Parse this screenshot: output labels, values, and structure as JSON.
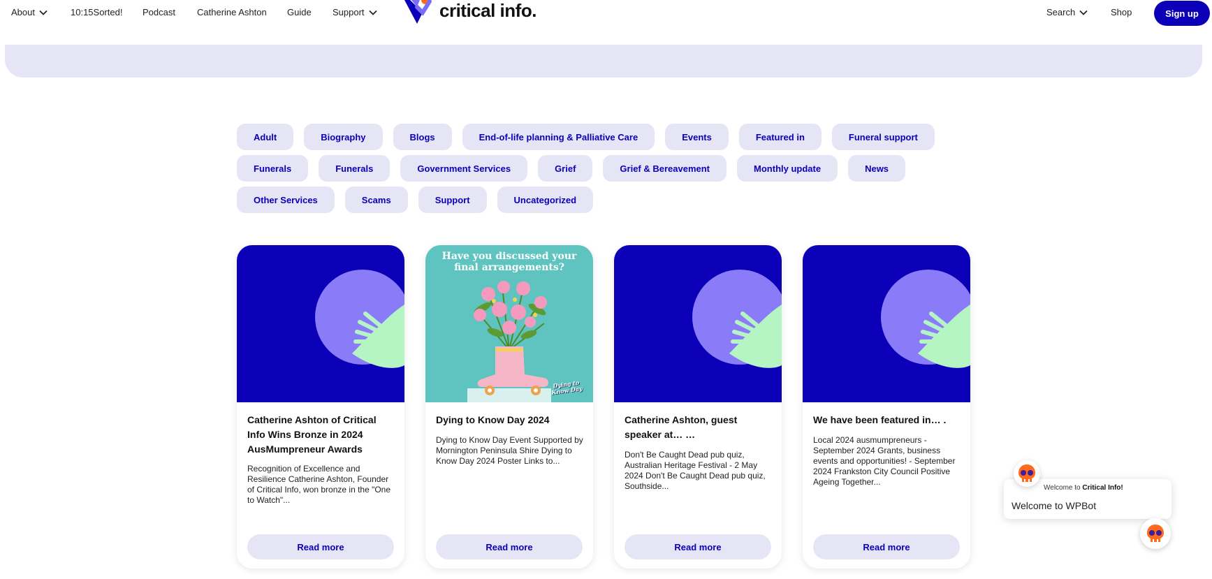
{
  "nav": {
    "about": "About",
    "sorted": "10:15Sorted!",
    "podcast": "Podcast",
    "catherine": "Catherine Ashton",
    "guide": "Guide",
    "support": "Support",
    "logo_text": "critical info.",
    "search": "Search",
    "shop": "Shop",
    "signup": "Sign up"
  },
  "categories": [
    "Adult",
    "Biography",
    "Blogs",
    "End-of-life planning & Palliative Care",
    "Events",
    "Featured in",
    "Funeral support",
    "Funerals",
    "Funerals",
    "Government Services",
    "Grief",
    "Grief & Bereavement",
    "Monthly update",
    "News",
    "Other Services",
    "Scams",
    "Support",
    "Uncategorized"
  ],
  "posts": [
    {
      "title": "Catherine Ashton of Critical Info Wins Bronze in 2024 AusMumpreneur Awards",
      "excerpt": "  Recognition of Excellence and Resilience Catherine Ashton, Founder of Critical Info, won bronze in the \"One to Watch\"...",
      "read_more": "Read more"
    },
    {
      "title": "Dying to Know Day 2024",
      "excerpt": "  Dying to Know Day Event Supported by Mornington Peninsula Shire Dying to Know Day 2024 Poster  Links to...",
      "read_more": "Read more",
      "image_heading": "Have you discussed your final arrangements?",
      "image_badge": "Dying to Know Day"
    },
    {
      "title": "Catherine Ashton, guest speaker at… …",
      "excerpt": "Don't Be Caught Dead pub quiz, Australian Heritage Festival - 2 May 2024 Don't Be Caught Dead pub quiz, Southside...",
      "read_more": "Read more"
    },
    {
      "title": "We have been featured in… .",
      "excerpt": "Local 2024 ausmumpreneurs - September 2024 Grants, business events and opportunities! - September 2024 Frankston City Council Positive Ageing Together...",
      "read_more": "Read more"
    }
  ],
  "chat": {
    "welcome_prefix": "Welcome to",
    "welcome_brand": "Critical Info!",
    "message": "Welcome to WPBot"
  },
  "colors": {
    "brand": "#0b00b8",
    "chip_bg": "#e6e5f6",
    "placeholder_circle": "#8a7cf8",
    "placeholder_hand": "#b5f5c3",
    "chat_icon": "#ff6b1a"
  }
}
